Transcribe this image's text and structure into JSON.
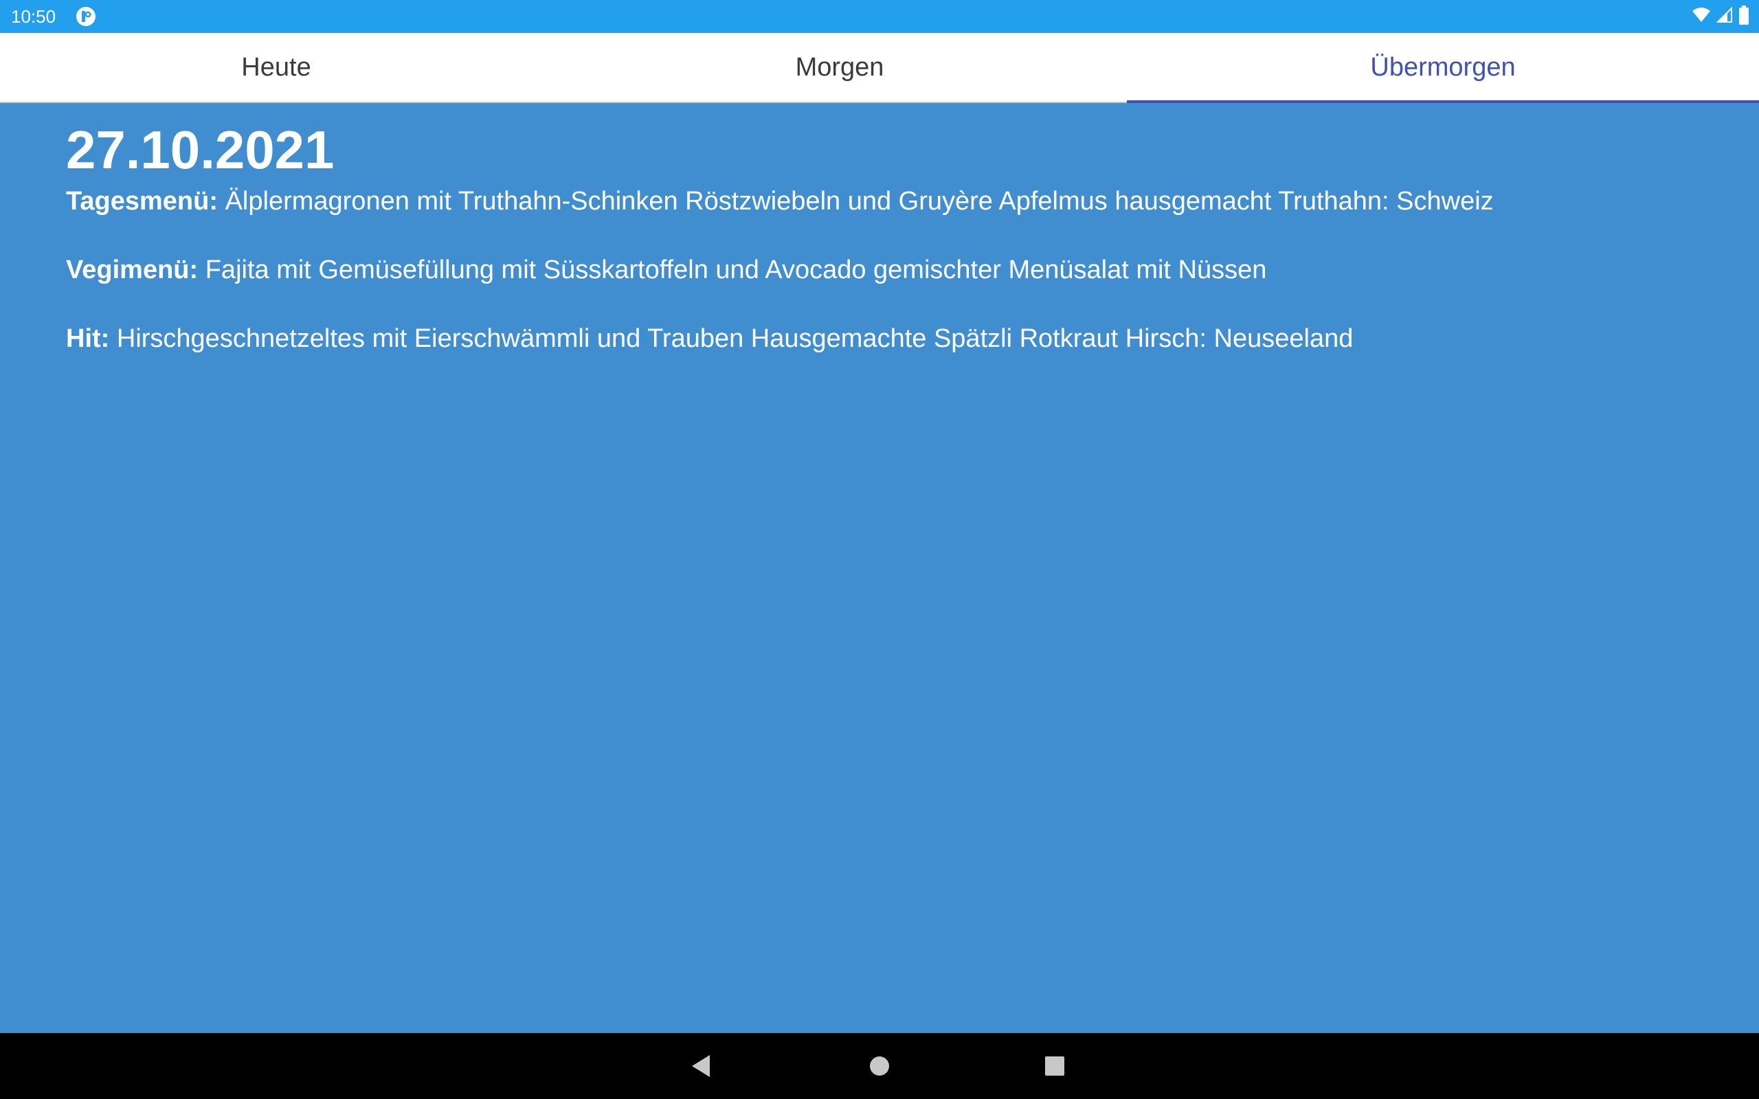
{
  "status_bar": {
    "time": "10:50",
    "icons": [
      "app-notification-icon",
      "wifi-icon",
      "cell-signal-icon",
      "battery-icon"
    ]
  },
  "tabs": [
    {
      "label": "Heute",
      "selected": false
    },
    {
      "label": "Morgen",
      "selected": false
    },
    {
      "label": "Übermorgen",
      "selected": true
    }
  ],
  "content": {
    "date": "27.10.2021",
    "menus": [
      {
        "label": "Tagesmenü:",
        "text": "Älplermagronen mit Truthahn-Schinken Röstzwiebeln und Gruyère Apfelmus hausgemacht Truthahn: Schweiz"
      },
      {
        "label": "Vegimenü:",
        "text": "Fajita mit Gemüsefüllung mit Süsskartoffeln und Avocado gemischter Menüsalat mit Nüssen"
      },
      {
        "label": "Hit:",
        "text": "Hirschgeschnetzeltes mit Eierschwämmli und Trauben Hausgemachte Spätzli Rotkraut Hirsch: Neuseeland"
      }
    ]
  },
  "nav_bar": {
    "buttons": [
      "back-icon",
      "home-icon",
      "recents-icon"
    ]
  },
  "colors": {
    "status_bar": "#22a0ee",
    "content_background": "#408ed0",
    "tab_selected": "#3f51b5",
    "tab_text": "#3b3b3b"
  }
}
